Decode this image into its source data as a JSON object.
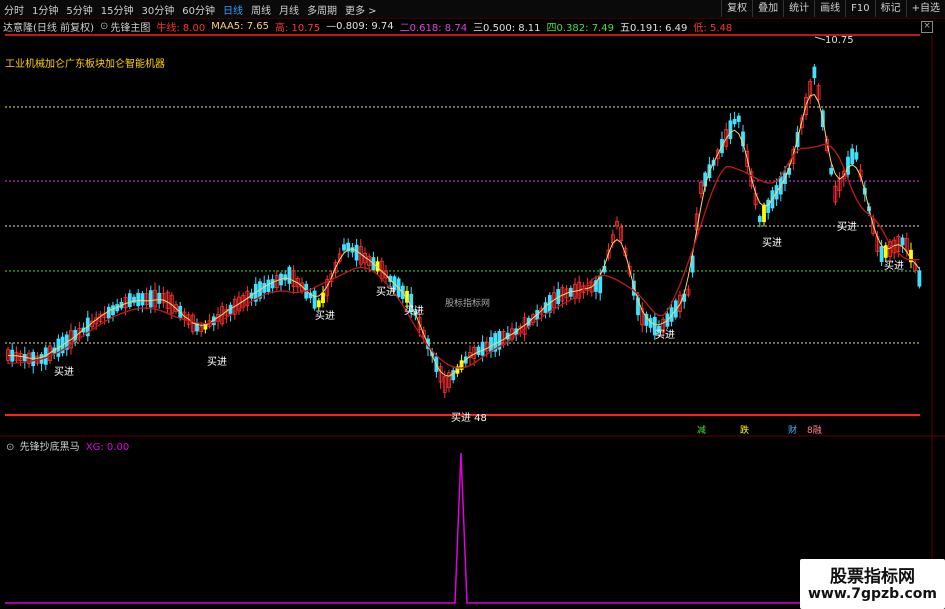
{
  "toolbar": {
    "periods": [
      "分时",
      "1分钟",
      "5分钟",
      "15分钟",
      "30分钟",
      "60分钟",
      "日线",
      "周线",
      "月线",
      "多周期",
      "更多 >"
    ],
    "active_period": "日线",
    "right_buttons": [
      "复权",
      "叠加",
      "统计",
      "画线",
      "F10",
      "标记",
      "+自选"
    ]
  },
  "info": {
    "stock_name": "达意隆(日线 前复权)",
    "indicator_name": "先锋主图",
    "cow_label": "牛线: 8.00",
    "maa5_label": "MAA5: 7.65",
    "high_label": "高: 10.75",
    "l1": "—0.809: 9.74",
    "l2": "二0.618: 8.74",
    "l3": "三0.500: 8.11",
    "l4": "四0.382: 7.49",
    "l5": "五0.191: 6.49",
    "low_label": "低: 5.48"
  },
  "main": {
    "annotation": "工业机械加仑广东板块加仑智能机器",
    "center_watermark": "股标指标网",
    "high_marker": "10.75",
    "low_marker": "买进 48",
    "buy_labels": [
      "买进",
      "买进",
      "买进",
      "买进",
      "买进",
      "买进",
      "买进",
      "买进",
      "买进",
      "买进"
    ],
    "fin_labels": [
      "减",
      "跌",
      "财",
      "8融"
    ]
  },
  "lower": {
    "indicator_name": "先锋抄底黑马",
    "xg_label": "XG: 0.00"
  },
  "brand": {
    "line1": "股票指标网",
    "line2": "www.7gpzb.com"
  },
  "colors": {
    "up": "#ff3030",
    "down": "#40e0ff",
    "signal": "#ffff00",
    "ma_yellow": "#ffd070",
    "ma_red": "#ff2020",
    "osc": "#e000e0"
  }
}
